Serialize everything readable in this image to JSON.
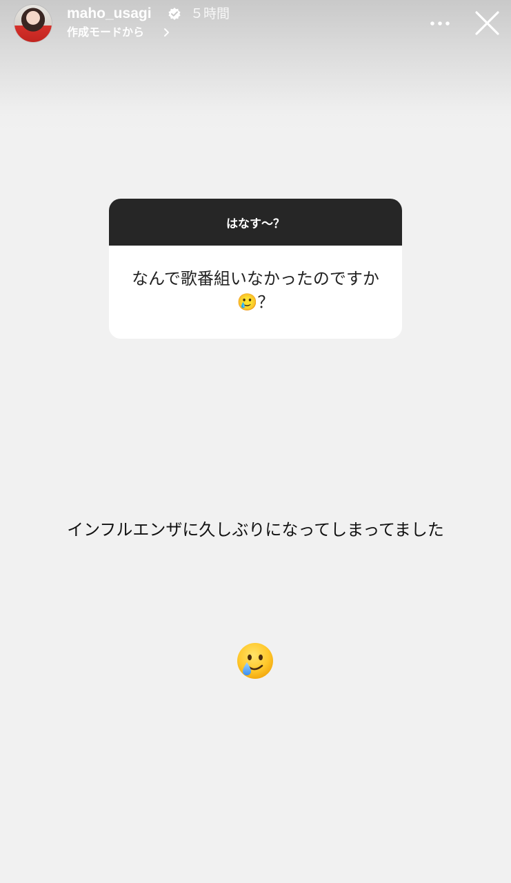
{
  "header": {
    "username": "maho_usagi",
    "time": "５時間",
    "subtitle": "作成モードから"
  },
  "question_card": {
    "title": "はなす〜？",
    "question": "なんで歌番組いなかったのですか🥲？"
  },
  "answer": {
    "text": "インフルエンザに久しぶりになってしまってました",
    "emoji": "🥲"
  },
  "icons": {
    "verified": "verified-badge-icon",
    "chevron": "chevron-right-icon",
    "more": "more-options-icon",
    "close": "close-icon",
    "emoji": "smiling-face-with-tear-icon"
  },
  "colors": {
    "background": "#f1f1f1",
    "card_header": "#262626",
    "card_body": "#ffffff"
  }
}
